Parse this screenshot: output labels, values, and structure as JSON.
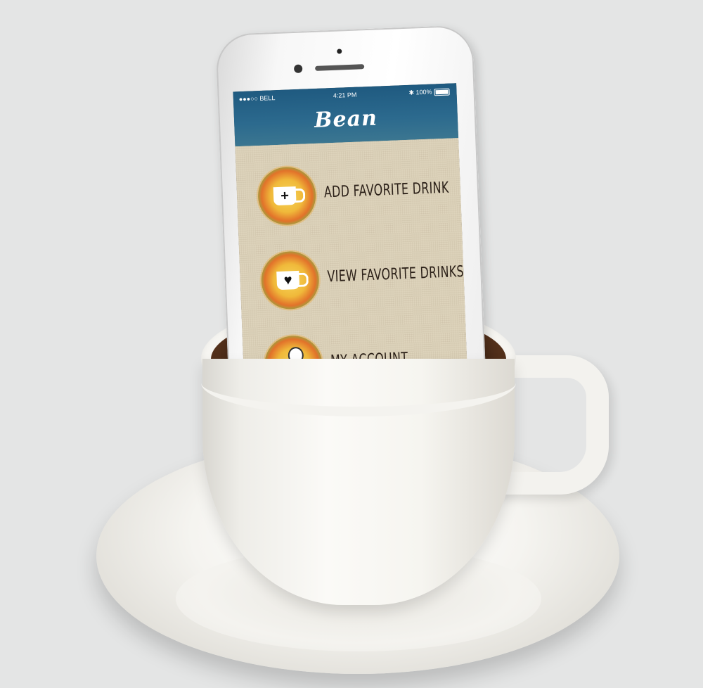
{
  "app": {
    "title": "Bean"
  },
  "status_bar": {
    "carrier": "●●●○○ BELL",
    "time": "4:21 PM",
    "battery": "100%"
  },
  "menu": {
    "items": [
      {
        "label": "ADD FAVORITE DRINK",
        "icon": "add-cup-icon",
        "glyph": "+"
      },
      {
        "label": "VIEW FAVORITE DRINKS",
        "icon": "heart-cup-icon",
        "glyph": "♥"
      },
      {
        "label": "MY ACCOUNT",
        "icon": "person-icon"
      }
    ]
  },
  "colors": {
    "nav_bar": "#2c6a8e",
    "background_linen": "#ddd3bb",
    "label_text": "#2c2119"
  }
}
